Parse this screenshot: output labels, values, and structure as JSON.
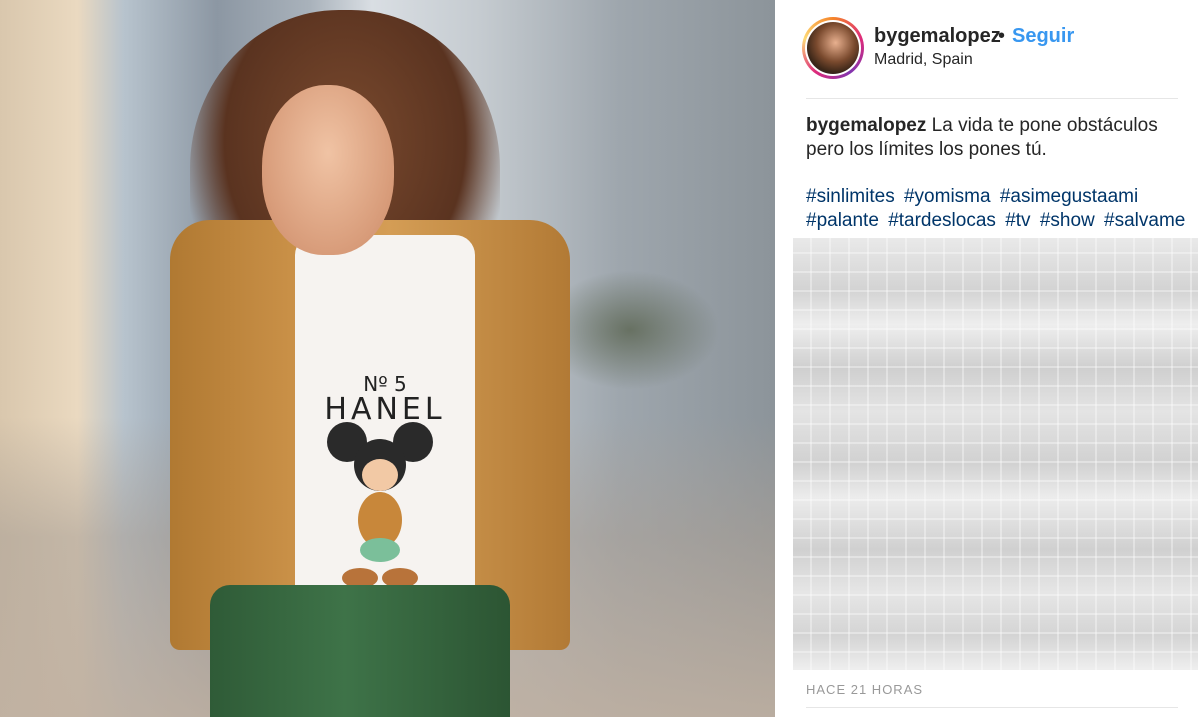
{
  "post": {
    "username": "bygemalopez",
    "separator": "•",
    "follow_label": "Seguir",
    "location": "Madrid, Spain",
    "caption_user": "bygemalopez",
    "caption_text": "La vida te pone obstáculos pero los límites los pones tú.",
    "hashtags": [
      "#sinlimites",
      "#yomisma",
      "#asimegustaami",
      "#palante",
      "#tardeslocas",
      "#tv",
      "#show",
      "#salvame"
    ],
    "timestamp": "HACE 21 HORAS"
  },
  "photo": {
    "shirt_number": "Nº 5",
    "shirt_text": "HANEL"
  },
  "colors": {
    "link": "#3897f0",
    "hashtag": "#003569",
    "text": "#262626",
    "muted": "#999999"
  }
}
